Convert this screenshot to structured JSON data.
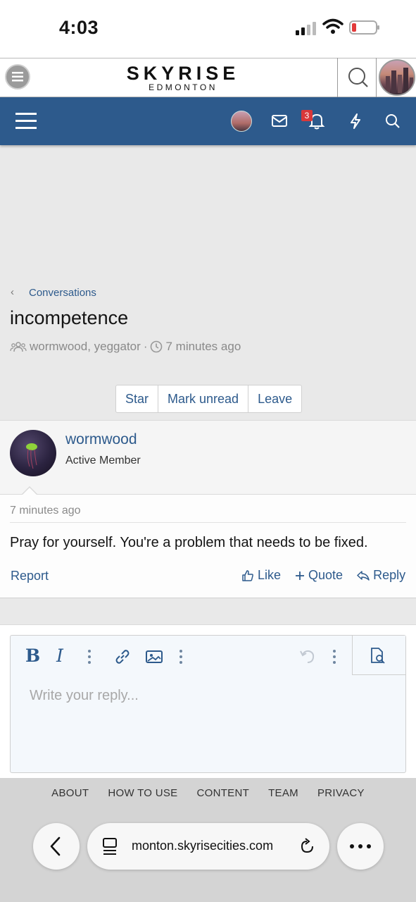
{
  "status_bar": {
    "time": "4:03"
  },
  "site_header": {
    "brand": "SKYRISE",
    "brand_sub": "EDMONTON"
  },
  "nav": {
    "alert_count": "3"
  },
  "breadcrumb": {
    "label": "Conversations"
  },
  "conversation": {
    "title": "incompetence",
    "participants": "wormwood, yeggator",
    "separator": "·",
    "time": "7 minutes ago",
    "buttons": [
      "Star",
      "Mark unread",
      "Leave"
    ]
  },
  "post": {
    "username": "wormwood",
    "role": "Active Member",
    "time": "7 minutes ago",
    "message": "Pray for yourself. You're a problem that needs to be fixed.",
    "report": "Report",
    "like": "Like",
    "quote": "Quote",
    "reply": "Reply"
  },
  "editor": {
    "placeholder": "Write your reply..."
  },
  "footer": {
    "links": [
      "ABOUT",
      "HOW TO USE",
      "CONTENT",
      "TEAM",
      "PRIVACY"
    ]
  },
  "browser": {
    "url": "monton.skyrisecities.com"
  }
}
